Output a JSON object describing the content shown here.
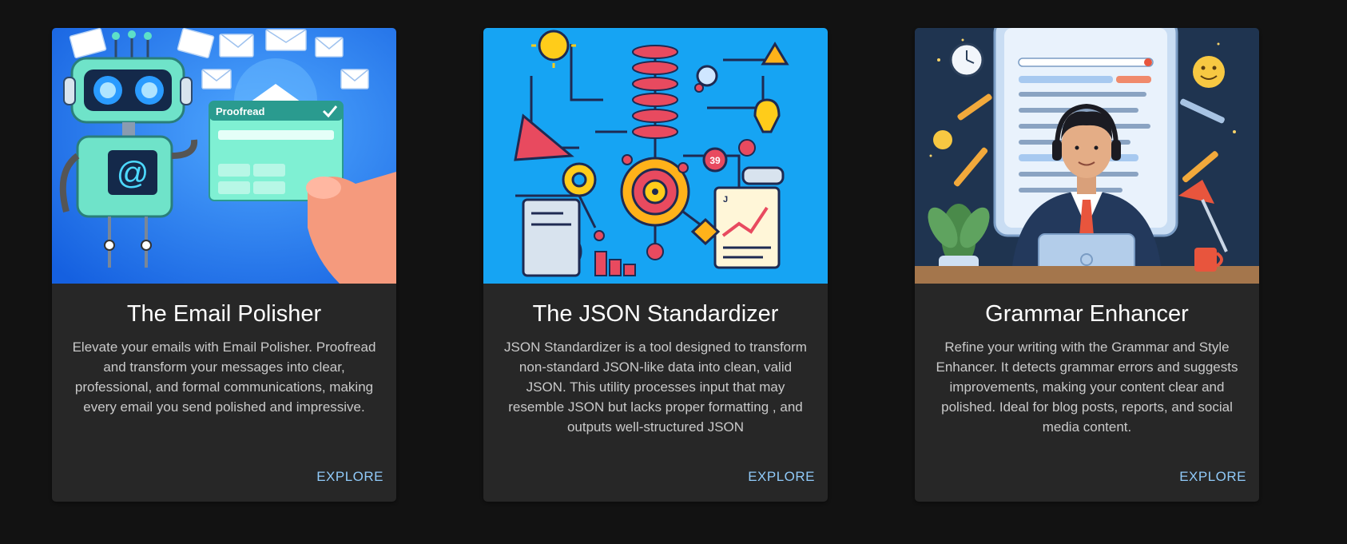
{
  "cards": [
    {
      "title": "The Email Polisher",
      "description": "Elevate your emails with Email Polisher. Proofread and transform your messages into clear, professional, and formal communications, making every email you send polished and impressive.",
      "action_label": "EXPLORE",
      "image_text": "Proofread",
      "image_icon": "robot-email-illustration"
    },
    {
      "title": "The JSON Standardizer",
      "description": "JSON Standardizer is a tool designed to transform non-standard JSON-like data into clean, valid JSON. This utility processes input that may resemble JSON but lacks proper formatting , and outputs well-structured JSON",
      "action_label": "EXPLORE",
      "image_icon": "json-data-illustration"
    },
    {
      "title": "Grammar Enhancer",
      "description": "Refine your writing with the Grammar and Style Enhancer. It detects grammar errors and suggests improvements, making your content clear and polished. Ideal for blog posts, reports, and social media content.",
      "action_label": "EXPLORE",
      "image_icon": "writer-at-desk-illustration"
    }
  ],
  "colors": {
    "page_background": "#121212",
    "card_background": "#272727",
    "title": "#ffffff",
    "description": "#c9c9c9",
    "action": "#90caf9"
  }
}
